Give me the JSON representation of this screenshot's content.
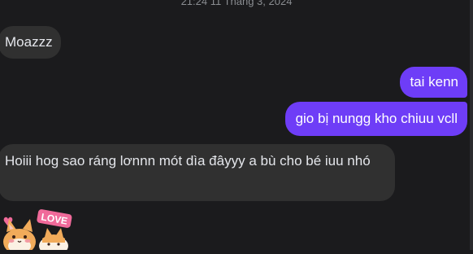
{
  "timestamp": "21:24 11 Tháng 3, 2024",
  "messages": [
    {
      "direction": "incoming",
      "text": "Moazzz"
    },
    {
      "direction": "outgoing",
      "text": "tai kenn"
    },
    {
      "direction": "outgoing",
      "text": "gio bị nungg kho chiuu vcll"
    },
    {
      "direction": "incoming",
      "text": "Hoiii hog sao ráng lơnnn mót dìa đâyyy a bù cho bé iuu nhó"
    }
  ],
  "sticker": {
    "label": "LOVE",
    "icon": "love-cat-sticker-icon"
  },
  "colors": {
    "background": "#1b1b1d",
    "incoming_bubble": "#303030",
    "outgoing_bubble": "#6e3df7",
    "text": "#e4e6eb"
  }
}
